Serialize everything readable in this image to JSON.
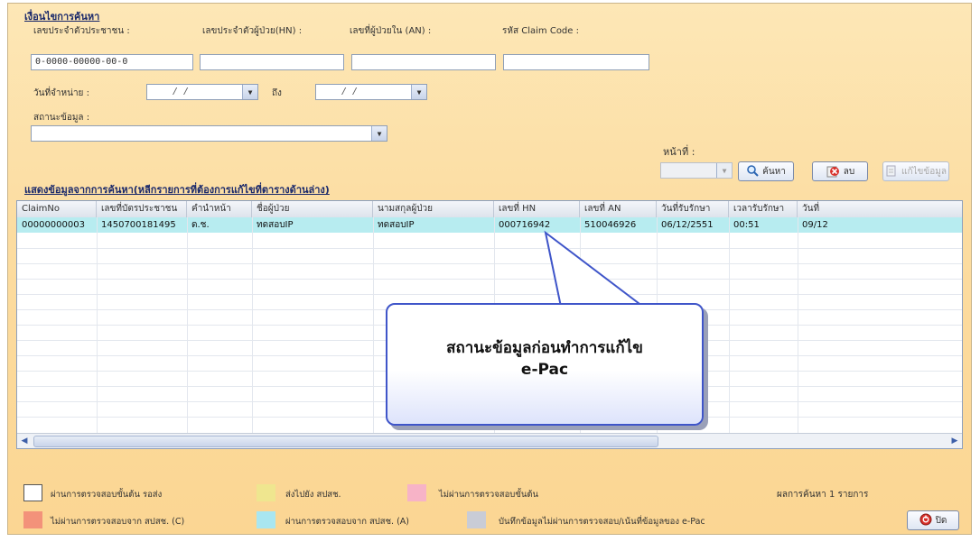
{
  "search": {
    "section_title": "เงื่อนไขการค้นหา",
    "labels": {
      "citizen_id": "เลขประจำตัวประชาชน :",
      "hn": "เลขประจำตัวผู้ป่วย(HN) :",
      "an": "เลขที่ผู้ป่วยใน (AN) :",
      "claim_code": "รหัส Claim Code :",
      "discharge_date": "วันที่จำหน่าย :",
      "to": "ถึง",
      "status": "สถานะข้อมูล :"
    },
    "citizen_id_value": "0-0000-00000-00-0",
    "hn_value": "",
    "an_value": "",
    "claim_code_value": "",
    "date_from": "/     /",
    "date_to": "/     /",
    "status_value": ""
  },
  "results": {
    "section_title": "แสดงข้อมูลจากการค้นหา(หลีกรายการที่ต้องการแก้ไขที่ตารางด้านล่าง)",
    "page_label": "หน้าที่ :",
    "page_value": "",
    "search_button": "ค้นหา",
    "delete_button": "ลบ",
    "edit_button": "แก้ไขข้อมูล"
  },
  "table": {
    "columns": [
      "ClaimNo",
      "เลขที่บัตรประชาชน",
      "คำนำหน้า",
      "ชื่อผู้ป่วย",
      "นามสกุลผู้ป่วย",
      "เลขที่ HN",
      "เลขที่ AN",
      "วันที่รับรักษา",
      "เวลารับรักษา",
      "วันที่"
    ],
    "rows": [
      [
        "00000000003",
        "1450700181495",
        "ด.ช.",
        "ทดสอบIP",
        "ทดสอบIP",
        "000716942",
        "510046926",
        "06/12/2551",
        "00:51",
        "09/12"
      ]
    ]
  },
  "callout": {
    "line1": "สถานะข้อมูลก่อนทำการแก้ไข",
    "line2": "e-Pac"
  },
  "legend": {
    "items": [
      {
        "label": "ผ่านการตรวจสอบขั้นต้น รอส่ง",
        "color": "#ffffff"
      },
      {
        "label": "ส่งไปยัง สปสช.",
        "color": "#efe68f"
      },
      {
        "label": "ไม่ผ่านการตรวจสอบขั้นต้น",
        "color": "#f7b3c7"
      },
      {
        "label": "ไม่ผ่านการตรวจสอบจาก สปสช. (C)",
        "color": "#f3927a"
      },
      {
        "label": "ผ่านการตรวจสอบจาก สปสช. (A)",
        "color": "#a9e6f0"
      },
      {
        "label": "บันทึกข้อมูลไม่ผ่านการตรวจสอบ/เน้นที่ข้อมูลของ e-Pac",
        "color": "#c9ccd6"
      }
    ],
    "result_count": "ผลการค้นหา 1 รายการ",
    "close_button": "ปิด"
  },
  "colors": {
    "accent": "#3f55c9",
    "selected_row": "#b7ecf0",
    "background": "#fcdca0"
  }
}
